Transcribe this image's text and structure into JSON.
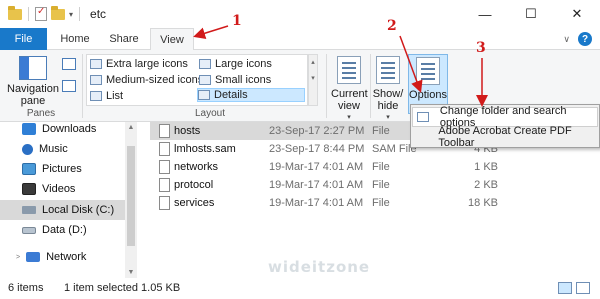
{
  "window": {
    "title": "etc",
    "minimize": "—",
    "maximize": "☐",
    "close": "✕"
  },
  "tabs": {
    "file": "File",
    "home": "Home",
    "share": "Share",
    "view": "View"
  },
  "ribbon": {
    "navigation_pane": "Navigation pane",
    "panes_label": "Panes",
    "layout_label": "Layout",
    "layout_items": {
      "extra_large": "Extra large icons",
      "large": "Large icons",
      "medium": "Medium-sized icons",
      "small": "Small icons",
      "list": "List",
      "details": "Details"
    },
    "current_view": "Current view",
    "show_hide": "Show/ hide",
    "options": "Options"
  },
  "options_menu": {
    "change_folder": "Change folder and search options",
    "acrobat": "Adobe Acrobat Create PDF Toolbar"
  },
  "sidebar": {
    "downloads": "Downloads",
    "music": "Music",
    "pictures": "Pictures",
    "videos": "Videos",
    "local_disk": "Local Disk (C:)",
    "data": "Data (D:)",
    "network": "Network"
  },
  "files": [
    {
      "name": "hosts",
      "date": "23-Sep-17 2:27 PM",
      "type": "File",
      "size": "1 KB"
    },
    {
      "name": "lmhosts.sam",
      "date": "23-Sep-17 8:44 PM",
      "type": "SAM File",
      "size": "4 KB"
    },
    {
      "name": "networks",
      "date": "19-Mar-17 4:01 AM",
      "type": "File",
      "size": "1 KB"
    },
    {
      "name": "protocol",
      "date": "19-Mar-17 4:01 AM",
      "type": "File",
      "size": "2 KB"
    },
    {
      "name": "services",
      "date": "19-Mar-17 4:01 AM",
      "type": "File",
      "size": "18 KB"
    }
  ],
  "status": {
    "items": "6 items",
    "selected": "1 item selected 1.05 KB"
  },
  "watermark": "wideitzone",
  "annotations": [
    "1",
    "2",
    "3"
  ],
  "colors": {
    "accent": "#1979ca",
    "annotation": "#d11a1a",
    "selection": "#cce8ff"
  }
}
